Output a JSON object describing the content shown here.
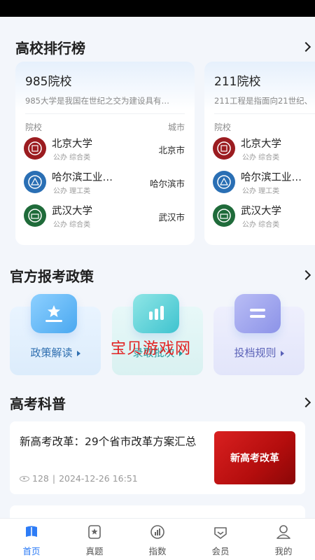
{
  "sections": {
    "ranking": "高校排行榜",
    "policy": "官方报考政策",
    "science": "高考科普"
  },
  "ranking_cards": [
    {
      "title": "985院校",
      "desc": "985大学是我国在世纪之交为建设具有…",
      "col_school": "院校",
      "col_city": "城市",
      "universities": [
        {
          "name": "北京大学",
          "meta": "公办 综合类",
          "city": "北京市"
        },
        {
          "name": "哈尔滨工业…",
          "meta": "公办 理工类",
          "city": "哈尔滨市"
        },
        {
          "name": "武汉大学",
          "meta": "公办 综合类",
          "city": "武汉市"
        }
      ]
    },
    {
      "title": "211院校",
      "desc": "211工程是指面向21世纪、",
      "col_school": "院校",
      "universities": [
        {
          "name": "北京大学",
          "meta": "公办 综合类"
        },
        {
          "name": "哈尔滨工业…",
          "meta": "公办 理工类"
        },
        {
          "name": "武汉大学",
          "meta": "公办 综合类"
        }
      ]
    }
  ],
  "policy_tiles": [
    {
      "label": "政策解读",
      "icon": "star-doc-icon"
    },
    {
      "label": "录取批次",
      "icon": "bar-chart-icon"
    },
    {
      "label": "投档规则",
      "icon": "list-icon"
    }
  ],
  "watermark": "宝贝游戏网",
  "article": {
    "title": "新高考改革：29个省市改革方案汇总",
    "views": "128",
    "date": "2024-12-26 16:51",
    "thumb_text": "新高考改革"
  },
  "nav": [
    {
      "label": "首页",
      "icon": "home-icon",
      "active": true
    },
    {
      "label": "真题",
      "icon": "star-book-icon"
    },
    {
      "label": "指数",
      "icon": "index-icon"
    },
    {
      "label": "会员",
      "icon": "vip-icon"
    },
    {
      "label": "我的",
      "icon": "profile-icon"
    }
  ],
  "colors": {
    "accent": "#2d7cf6",
    "pku": "#9b1c20",
    "hit": "#2a6fb4",
    "whu": "#1f6b3a",
    "watermark": "#e22222"
  }
}
